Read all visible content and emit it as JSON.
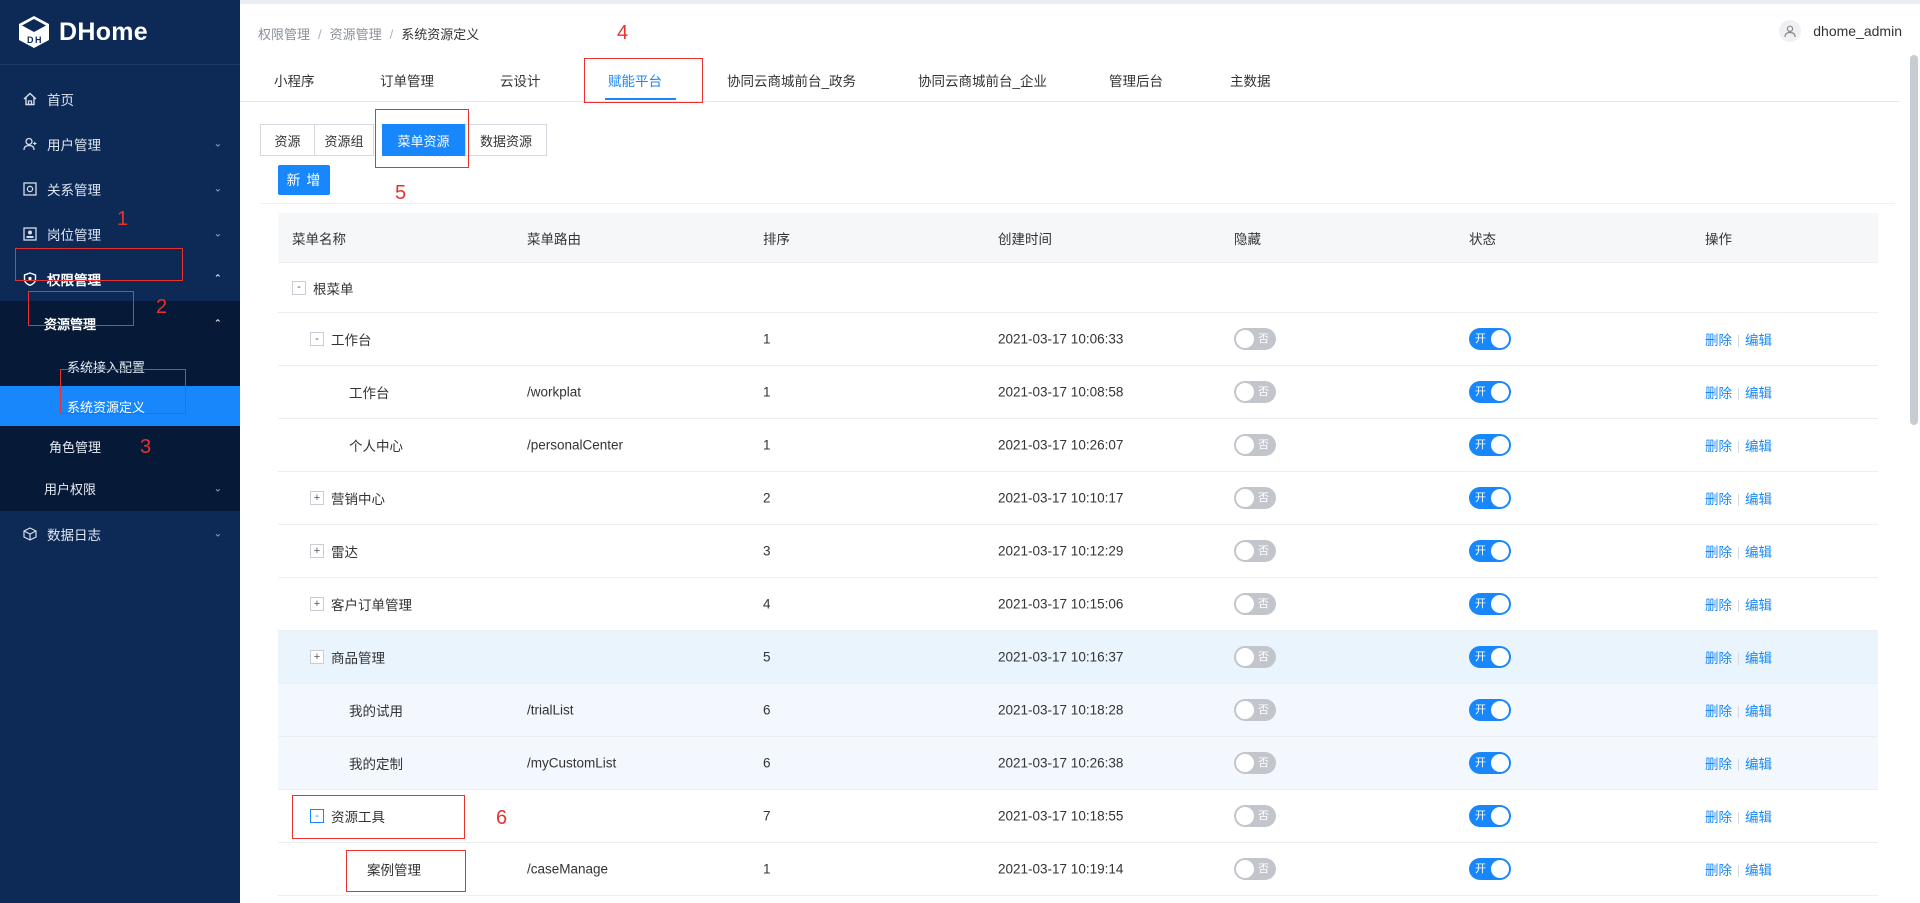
{
  "app": {
    "logo_text": "DHome"
  },
  "sidebar": {
    "items": [
      {
        "label": "首页"
      },
      {
        "label": "用户管理"
      },
      {
        "label": "关系管理"
      },
      {
        "label": "岗位管理"
      },
      {
        "label": "权限管理"
      },
      {
        "label": "数据日志"
      }
    ],
    "sub": {
      "resource_mgmt": "资源管理",
      "system_access": "系统接入配置",
      "system_resource_def": "系统资源定义",
      "role_mgmt": "角色管理",
      "user_perm": "用户权限"
    }
  },
  "header": {
    "breadcrumb": [
      "权限管理",
      "资源管理",
      "系统资源定义"
    ],
    "separator": "/",
    "username": "dhome_admin"
  },
  "tabs": [
    "小程序",
    "订单管理",
    "云设计",
    "赋能平台",
    "协同云商城前台_政务",
    "协同云商城前台_企业",
    "管理后台",
    "主数据"
  ],
  "segments": [
    "资源",
    "资源组",
    "菜单资源",
    "数据资源"
  ],
  "add_button": "新 增",
  "table": {
    "headers": [
      "菜单名称",
      "菜单路由",
      "排序",
      "创建时间",
      "隐藏",
      "状态",
      "操作"
    ],
    "switch_off_text": "否",
    "switch_on_text": "开",
    "op_delete": "删除",
    "op_edit": "编辑",
    "root": {
      "expander": "-",
      "name": "根菜单"
    },
    "rows": [
      {
        "expander": "-",
        "name": "工作台",
        "route": "",
        "sort": "1",
        "time": "2021-03-17 10:06:33"
      },
      {
        "expander": "",
        "name": "工作台",
        "route": "/workplat",
        "sort": "1",
        "time": "2021-03-17 10:08:58"
      },
      {
        "expander": "",
        "name": "个人中心",
        "route": "/personalCenter",
        "sort": "1",
        "time": "2021-03-17 10:26:07"
      },
      {
        "expander": "+",
        "name": "营销中心",
        "route": "",
        "sort": "2",
        "time": "2021-03-17 10:10:17"
      },
      {
        "expander": "+",
        "name": "雷达",
        "route": "",
        "sort": "3",
        "time": "2021-03-17 10:12:29"
      },
      {
        "expander": "+",
        "name": "客户订单管理",
        "route": "",
        "sort": "4",
        "time": "2021-03-17 10:15:06"
      },
      {
        "expander": "+",
        "name": "商品管理",
        "route": "",
        "sort": "5",
        "time": "2021-03-17 10:16:37"
      },
      {
        "expander": "",
        "name": "我的试用",
        "route": "/trialList",
        "sort": "6",
        "time": "2021-03-17 10:18:28"
      },
      {
        "expander": "",
        "name": "我的定制",
        "route": "/myCustomList",
        "sort": "6",
        "time": "2021-03-17 10:26:38"
      },
      {
        "expander": "-",
        "name": "资源工具",
        "route": "",
        "sort": "7",
        "time": "2021-03-17 10:18:55"
      },
      {
        "expander": "",
        "name": "案例管理",
        "route": "/caseManage",
        "sort": "1",
        "time": "2021-03-17 10:19:14"
      }
    ]
  },
  "annotations": [
    "1",
    "2",
    "3",
    "4",
    "5",
    "6"
  ],
  "colors": {
    "sidebar_bg": "#0d2a57",
    "submenu_bg": "#061937",
    "accent": "#1787fb",
    "annotation": "#e8322f"
  }
}
